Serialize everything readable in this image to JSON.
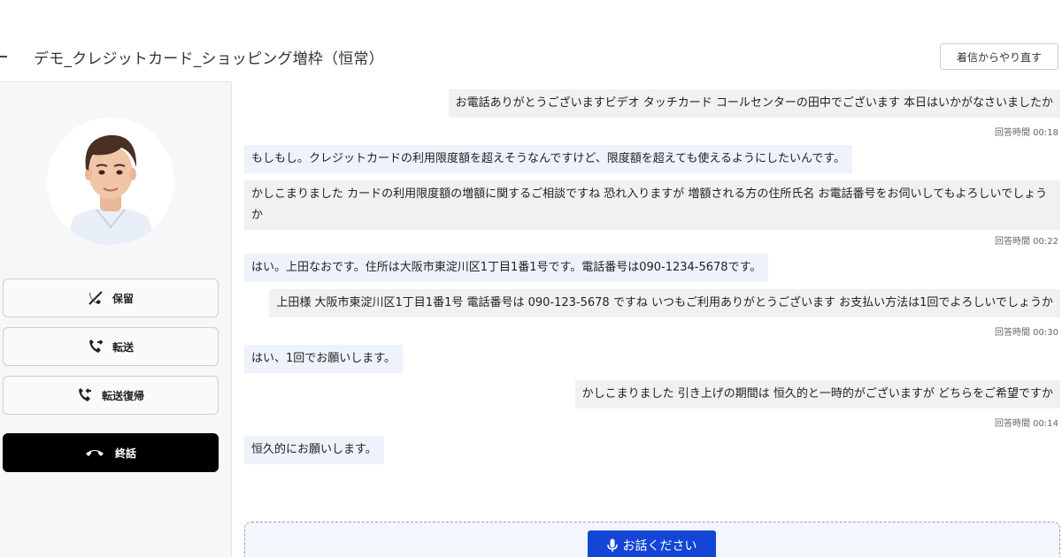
{
  "header": {
    "title": "デモ_クレジットカード_ショッピング増枠（恒常）",
    "restart_label": "着信からやり直す"
  },
  "sidebar": {
    "buttons": {
      "hold": "保留",
      "transfer": "転送",
      "transfer_return": "転送復帰",
      "end_call": "終話"
    }
  },
  "chat": {
    "messages": [
      {
        "role": "agent",
        "text": "お電話ありがとうございますビデオ タッチカード コールセンターの田中でございます 本日はいかがなさいましたか",
        "time": "回答時間 00:18"
      },
      {
        "role": "customer",
        "text": "もしもし。クレジットカードの利用限度額を超えそうなんですけど、限度額を超えても使えるようにしたいんです。"
      },
      {
        "role": "agent",
        "text": "かしこまりました カードの利用限度額の増額に関するご相談ですね 恐れ入りますが 増額される方の住所氏名 お電話番号をお伺いしてもよろしいでしょうか",
        "time": "回答時間 00:22"
      },
      {
        "role": "customer",
        "text": "はい。上田なおです。住所は大阪市東淀川区1丁目1番1号です。電話番号は090-1234-5678です。"
      },
      {
        "role": "agent",
        "text": "上田様 大阪市東淀川区1丁目1番1号 電話番号は 090-123-5678 ですね いつもご利用ありがとうございます お支払い方法は1回でよろしいでしょうか",
        "time": "回答時間 00:30"
      },
      {
        "role": "customer",
        "text": "はい、1回でお願いします。"
      },
      {
        "role": "agent",
        "text": "かしこまりました 引き上げの期間は 恒久的と一時的がございますが どちらをご希望ですか",
        "time": "回答時間 00:14"
      },
      {
        "role": "customer",
        "text": "恒久的にお願いします。"
      }
    ]
  },
  "input": {
    "mic_label": "お話ください"
  },
  "colors": {
    "accent": "#1346d6",
    "end_call": "#000000",
    "customer_bubble": "#eef2fb",
    "agent_bubble": "#f1f1f1"
  },
  "icons": {
    "hold": "phone-hold-icon",
    "transfer": "phone-forward-icon",
    "transfer_return": "phone-return-icon",
    "end_call": "hang-up-icon",
    "mic": "microphone-icon"
  }
}
